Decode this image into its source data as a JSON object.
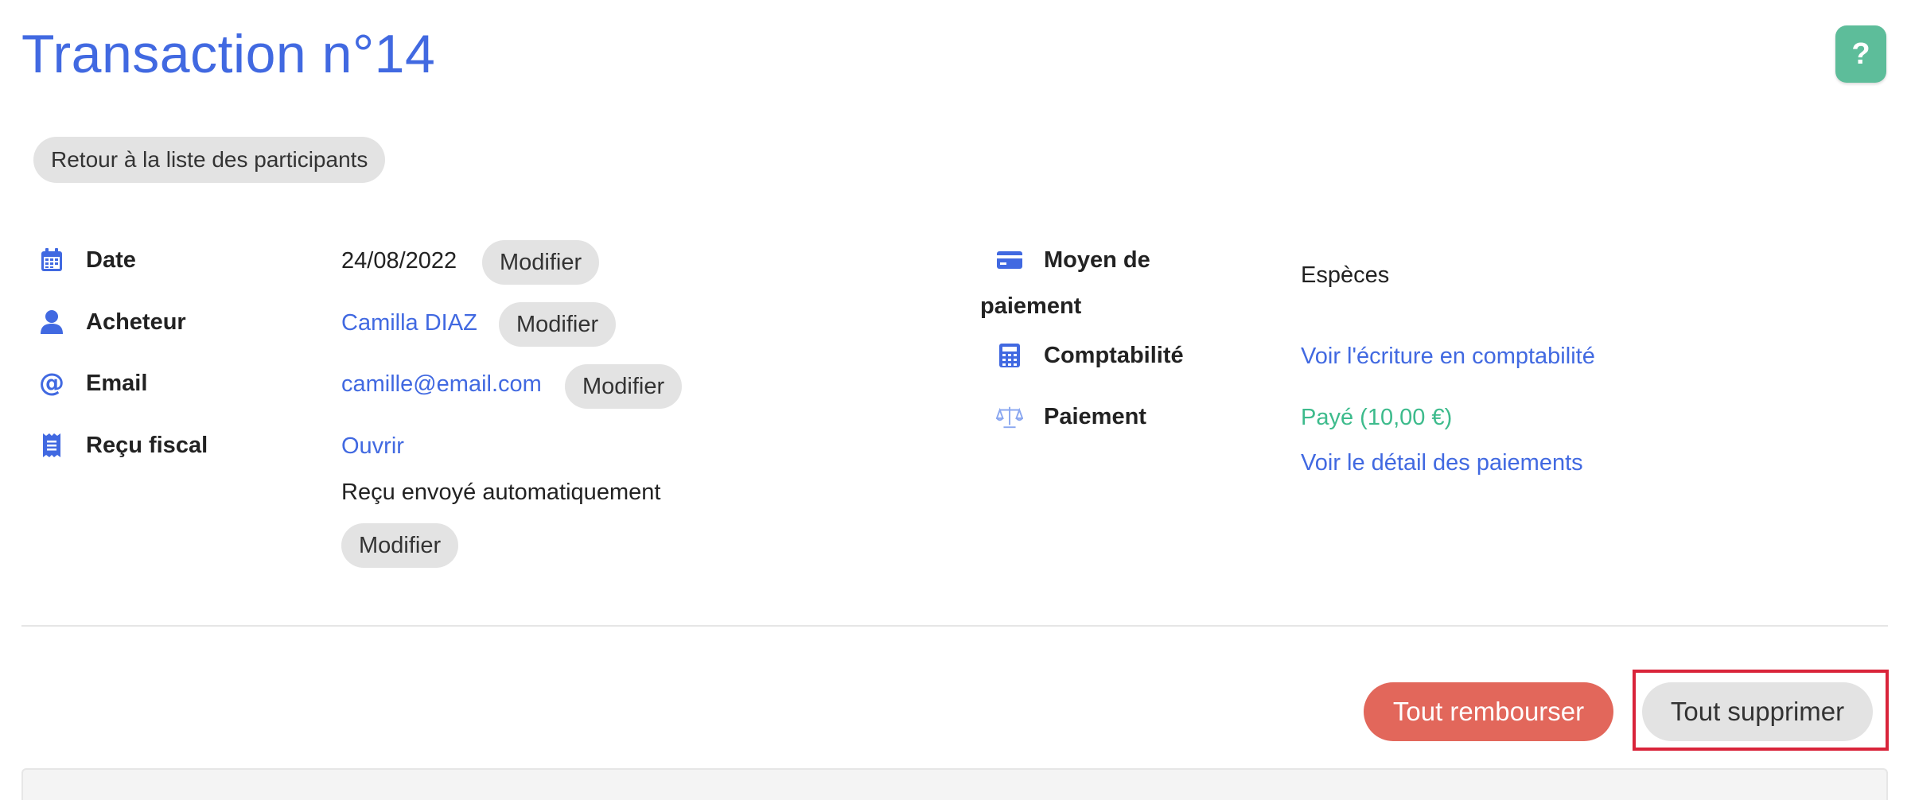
{
  "page": {
    "title": "Transaction n°14"
  },
  "help": {
    "label": "?"
  },
  "nav": {
    "back_label": "Retour à la liste des participants"
  },
  "details_left": {
    "date": {
      "label": "Date",
      "value": "24/08/2022",
      "action": "Modifier"
    },
    "buyer": {
      "label": "Acheteur",
      "value": "Camilla DIAZ",
      "action": "Modifier"
    },
    "email": {
      "label": "Email",
      "value": "camille@email.com",
      "action": "Modifier"
    },
    "receipt": {
      "label": "Reçu fiscal",
      "open_link": "Ouvrir",
      "note": "Reçu envoyé automatiquement",
      "action": "Modifier"
    }
  },
  "details_right": {
    "payment_method": {
      "label_line1": "Moyen de",
      "label_line2": "paiement",
      "value": "Espèces"
    },
    "accounting": {
      "label": "Comptabilité",
      "link": "Voir l'écriture en comptabilité"
    },
    "payment": {
      "label": "Paiement",
      "status": "Payé (10,00 €)",
      "detail_link": "Voir le détail des paiements"
    }
  },
  "actions": {
    "refund_all": "Tout rembourser",
    "delete_all": "Tout supprimer"
  },
  "colors": {
    "accent": "#4169e1",
    "success": "#3dbb8c",
    "danger": "#e2675b",
    "help": "#5dbd9a",
    "highlight": "#d9243a"
  }
}
